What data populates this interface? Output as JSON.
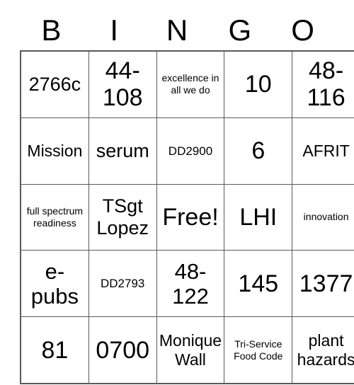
{
  "card": {
    "title": "BINGO",
    "header_letters": [
      "B",
      "I",
      "N",
      "G",
      "O"
    ],
    "free_space_label": "Free!",
    "grid": [
      [
        {
          "text": "2766c",
          "size": "sz-l"
        },
        {
          "text": "44-108",
          "size": "sz-xxl"
        },
        {
          "text": "excellence in all we do",
          "size": "sz-xs"
        },
        {
          "text": "10",
          "size": "sz-xxl"
        },
        {
          "text": "48-116",
          "size": "sz-xxl"
        }
      ],
      [
        {
          "text": "Mission",
          "size": "sz-m"
        },
        {
          "text": "serum",
          "size": "sz-l"
        },
        {
          "text": "DD2900",
          "size": "sz-s"
        },
        {
          "text": "6",
          "size": "sz-xxl"
        },
        {
          "text": "AFRIT",
          "size": "sz-m"
        }
      ],
      [
        {
          "text": "full spectrum readiness",
          "size": "sz-xs"
        },
        {
          "text": "TSgt Lopez",
          "size": "sz-l"
        },
        {
          "text": "Free!",
          "size": "sz-xxl"
        },
        {
          "text": "LHI",
          "size": "sz-xxl"
        },
        {
          "text": "innovation",
          "size": "sz-xs"
        }
      ],
      [
        {
          "text": "e-pubs",
          "size": "sz-xl"
        },
        {
          "text": "DD2793",
          "size": "sz-s"
        },
        {
          "text": "48-122",
          "size": "sz-xl"
        },
        {
          "text": "145",
          "size": "sz-xxl"
        },
        {
          "text": "1377",
          "size": "sz-xxl"
        }
      ],
      [
        {
          "text": "81",
          "size": "sz-xxl"
        },
        {
          "text": "0700",
          "size": "sz-xxl"
        },
        {
          "text": "Monique Wall",
          "size": "sz-m"
        },
        {
          "text": "Tri-Service Food Code",
          "size": "sz-xs"
        },
        {
          "text": "plant hazards",
          "size": "sz-m"
        }
      ]
    ]
  },
  "colors": {
    "border": "#595959",
    "text": "#000000",
    "background": "#ffffff"
  }
}
